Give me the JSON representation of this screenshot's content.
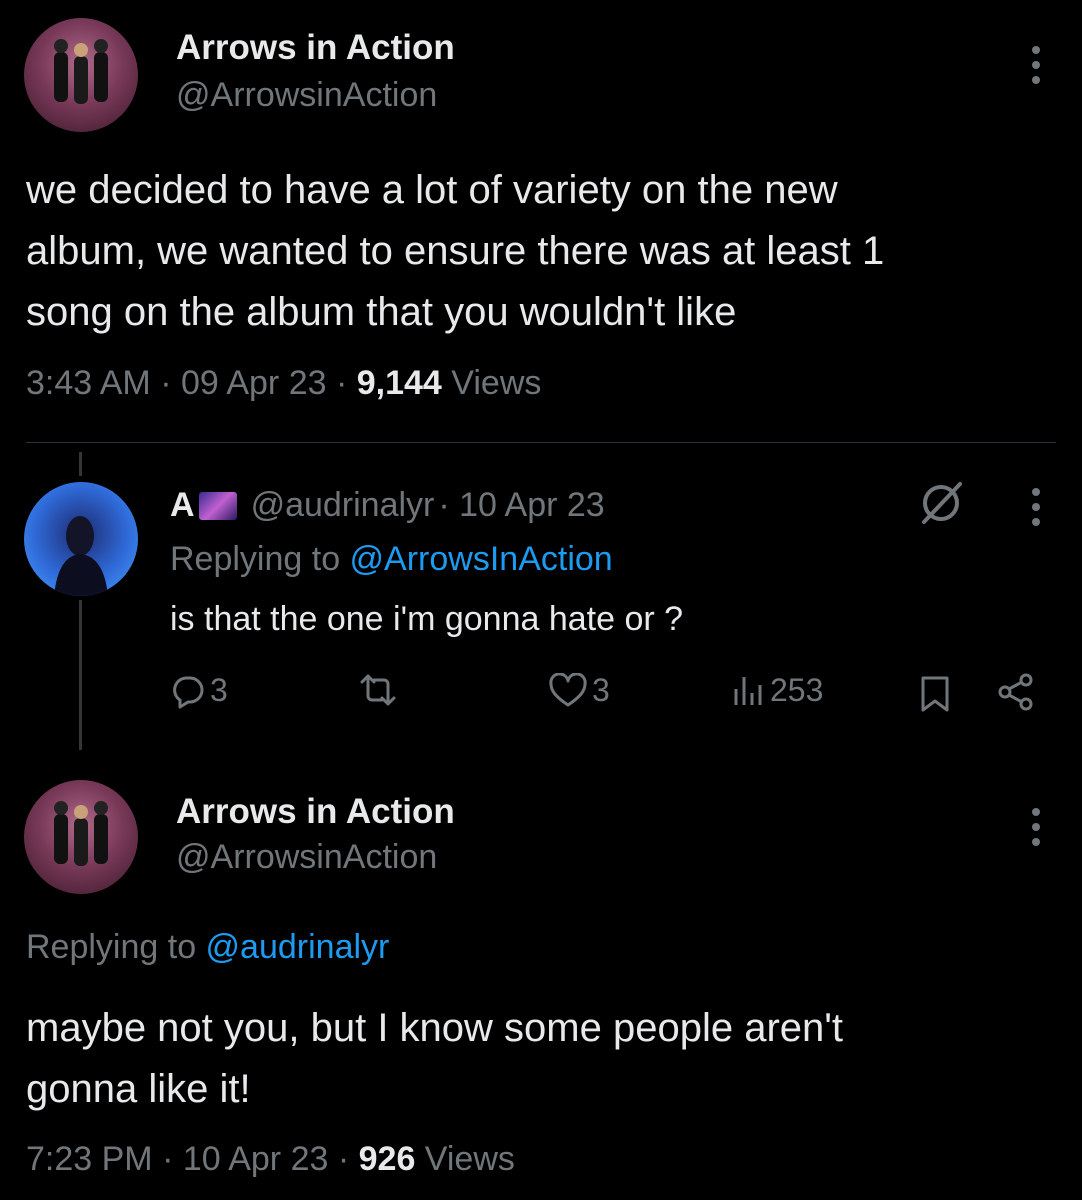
{
  "tweet1": {
    "name": "Arrows in Action",
    "handle": "@ArrowsinAction",
    "text_lines": [
      "we decided to have a lot of variety on the new",
      "album, we wanted to ensure there was at least 1",
      "song on the album that you wouldn't like"
    ],
    "time": "3:43 AM · 09 Apr 23 · ",
    "views_count": "9,144",
    "views_label": " Views"
  },
  "reply": {
    "name": "A",
    "handle": "@audrinalyr",
    "date": " · 10 Apr 23",
    "replying_prefix": "Replying to ",
    "replying_to": "@ArrowsInAction",
    "text": "is that the one i'm gonna hate or ?",
    "actions": {
      "replies": "3",
      "likes": "3",
      "views": "253"
    }
  },
  "tweet2": {
    "name": "Arrows in Action",
    "handle": "@ArrowsinAction",
    "replying_prefix": "Replying to ",
    "replying_to": "@audrinalyr",
    "text_lines": [
      "maybe not you, but I know some people aren't",
      "gonna like it!"
    ],
    "time": "7:23 PM · 10 Apr 23 · ",
    "views_count": "926",
    "views_label": " Views"
  },
  "colors": {
    "background": "#000000",
    "text": "#e7e9ea",
    "secondary": "#71767b",
    "link": "#1d9bf0"
  }
}
